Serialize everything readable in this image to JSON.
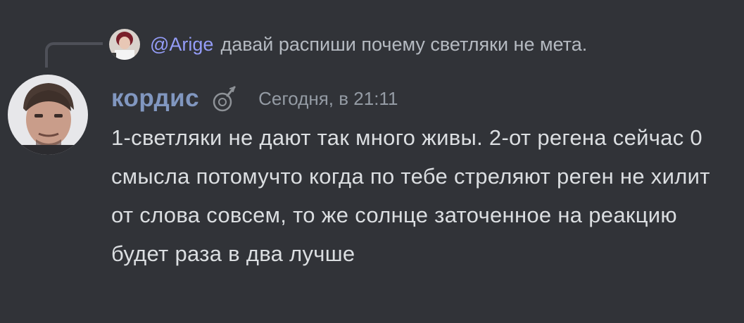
{
  "reply": {
    "mention": "@Arige",
    "text": "давай распиши почему светляки не мета."
  },
  "message": {
    "author": "кордис",
    "timestamp": "Сегодня, в 21:11",
    "content": "1-светляки не дают так много живы. 2-от регена сейчас 0 смысла потомучто когда по тебе стреляют реген не хилит от слова совсем, то же солнце заточенное на реакцию будет раза в два лучше"
  },
  "colors": {
    "background": "#313338",
    "author": "#8197c0",
    "mention": "#949cf7",
    "text": "#dbdee1",
    "timestamp": "#949ba4"
  },
  "icons": {
    "role": "nitro-role-icon"
  }
}
